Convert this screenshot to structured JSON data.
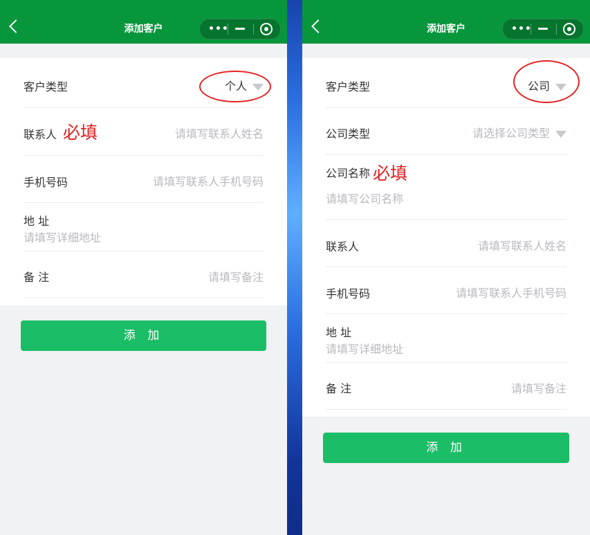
{
  "left": {
    "nav": {
      "title": "添加客户",
      "more": "•••"
    },
    "customer_type": {
      "label": "客户类型",
      "value": "个人"
    },
    "contact": {
      "label": "联系人",
      "required": "必填",
      "placeholder": "请填写联系人姓名"
    },
    "phone": {
      "label": "手机号码",
      "placeholder": "请填写联系人手机号码"
    },
    "address": {
      "label": "地 址",
      "placeholder": "请填写详细地址"
    },
    "remark": {
      "label": "备 注",
      "placeholder": "请填写备注"
    },
    "submit_label": "添 加"
  },
  "right": {
    "nav": {
      "title": "添加客户",
      "more": "•••"
    },
    "customer_type": {
      "label": "客户类型",
      "value": "公司"
    },
    "company_type": {
      "label": "公司类型",
      "placeholder": "请选择公司类型"
    },
    "company_name": {
      "label": "公司名称",
      "required": "必填",
      "placeholder": "请填写公司名称"
    },
    "contact": {
      "label": "联系人",
      "placeholder": "请填写联系人姓名"
    },
    "phone": {
      "label": "手机号码",
      "placeholder": "请填写联系人手机号码"
    },
    "address": {
      "label": "地 址",
      "placeholder": "请填写详细地址"
    },
    "remark": {
      "label": "备 注",
      "placeholder": "请填写备注"
    },
    "submit_label": "添 加"
  },
  "colors": {
    "nav_bg": "#07963c",
    "button_bg": "#1bbd66",
    "required_text": "#e02020",
    "annotation_circle": "#e32222"
  }
}
